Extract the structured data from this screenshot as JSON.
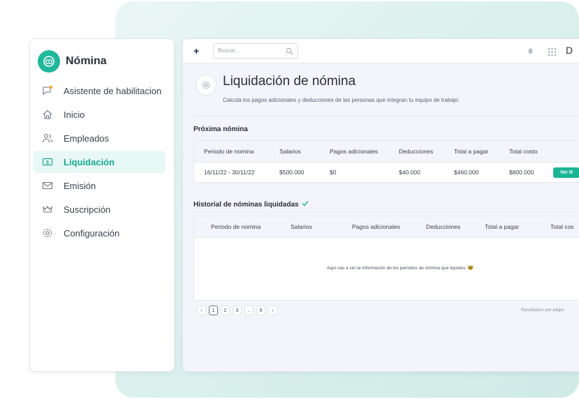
{
  "brand": {
    "title": "Nómina",
    "accent": "#1fb89c"
  },
  "sidebar": {
    "items": [
      {
        "label": "Asistente de habilitacion",
        "icon": "flag-notification-icon",
        "active": false
      },
      {
        "label": "Inicio",
        "icon": "home-icon",
        "active": false
      },
      {
        "label": "Empleados",
        "icon": "users-icon",
        "active": false
      },
      {
        "label": "Liquidación",
        "icon": "money-bill-icon",
        "active": true
      },
      {
        "label": "Emisión",
        "icon": "mail-icon",
        "active": false
      },
      {
        "label": "Suscripción",
        "icon": "crown-icon",
        "active": false
      },
      {
        "label": "Configuración",
        "icon": "gear-icon",
        "active": false
      }
    ]
  },
  "topbar": {
    "add_label": "+",
    "search_placeholder": "Buscar...",
    "user_initial": "D"
  },
  "page": {
    "title": "Liquidación de nómina",
    "subtitle": "Calcula los pagos adicionales y deducciones de las personas que integran tu equipo de trabajo"
  },
  "next_payroll": {
    "title": "Próxima nómina",
    "headers": [
      "Periodo de nomina",
      "Salarios",
      "Pagos adicionales",
      "Deducciones",
      "Total a pagar",
      "Total costo"
    ],
    "row": {
      "period": "16/11/22 - 30/11/22",
      "salaries": "$500.000",
      "additional": "$0",
      "deductions": "$40.000",
      "total_pay": "$460.000",
      "total_cost": "$800.000",
      "action": "Ver N"
    }
  },
  "history": {
    "title": "Historial de nóminas liquidadas",
    "headers": [
      "Periodo de nomina",
      "Salarios",
      "Pagos adicionales",
      "Deducciones",
      "Total a pagar",
      "Total cos"
    ],
    "empty_message": "Aquí vas a ver la información de los periodos de nómina que liquides. 🤓"
  },
  "pagination": {
    "prev": "‹",
    "pages": [
      "1",
      "2",
      "3",
      "..",
      "9"
    ],
    "next": "›",
    "results_label": "Resultados por págin"
  }
}
